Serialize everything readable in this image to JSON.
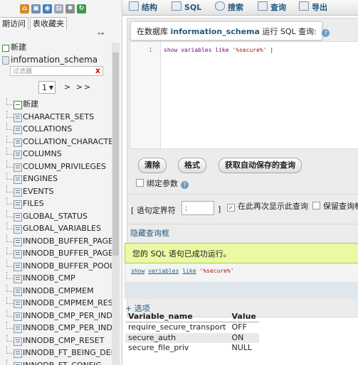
{
  "left_panel": {
    "tabs": [
      "期访问",
      "表收藏夹"
    ],
    "tree_top": [
      {
        "label": "新建"
      },
      {
        "label": "information_schema"
      }
    ],
    "filter_placeholder": "过滤器",
    "filter_clear": "X",
    "page_select_value": "1",
    "page_nav": "> >>",
    "tables": [
      "新建",
      "CHARACTER_SETS",
      "COLLATIONS",
      "COLLATION_CHARACTER",
      "COLUMNS",
      "COLUMN_PRIVILEGES",
      "ENGINES",
      "EVENTS",
      "FILES",
      "GLOBAL_STATUS",
      "GLOBAL_VARIABLES",
      "INNODB_BUFFER_PAGE",
      "INNODB_BUFFER_PAGE_",
      "INNODB_BUFFER_POOL_",
      "INNODB_CMP",
      "INNODB_CMPMEM",
      "INNODB_CMPMEM_RESI",
      "INNODB_CMP_PER_INDE",
      "INNODB_CMP_PER_INDE",
      "INNODB_CMP_RESET",
      "INNODB_FT_BEING_DELE",
      "INNODB_FT_CONFIG"
    ]
  },
  "topnav": {
    "items": [
      "结构",
      "SQL",
      "搜索",
      "查询",
      "导出"
    ]
  },
  "sql_panel": {
    "title_prefix": "在数据库",
    "db_name": "information_schema",
    "title_suffix": "运行 SQL 查询:",
    "line_number": "1",
    "code_kw1": "show",
    "code_kw2": "variables",
    "code_kw3": "like",
    "code_str": "'%secure%'",
    "buttons": {
      "clear": "清除",
      "format": "格式",
      "autosave": "获取自动保存的查询"
    },
    "bind_params": "绑定参数",
    "delimiter_label_open": "[ 语句定界符",
    "delimiter_value": ";",
    "delimiter_label_close": "]",
    "show_again": "在此再次显示此查询",
    "keep_query": "保留查询框",
    "hide_link": "隐藏查询框"
  },
  "result": {
    "success_msg": "您的 SQL 语句已成功运行。",
    "query_kw1": "show",
    "query_kw2": "variables",
    "query_kw3": "like",
    "query_str": "'%secure%'",
    "options_link": "+ 选项",
    "columns": [
      "Variable_name",
      "Value"
    ],
    "rows": [
      [
        "require_secure_transport",
        "OFF"
      ],
      [
        "secure_auth",
        "ON"
      ],
      [
        "secure_file_priv",
        "NULL"
      ]
    ]
  },
  "colors": {
    "link": "#235a81",
    "success_bg": "#ebf8a4",
    "keyword": "#770088",
    "string": "#aa1111"
  }
}
